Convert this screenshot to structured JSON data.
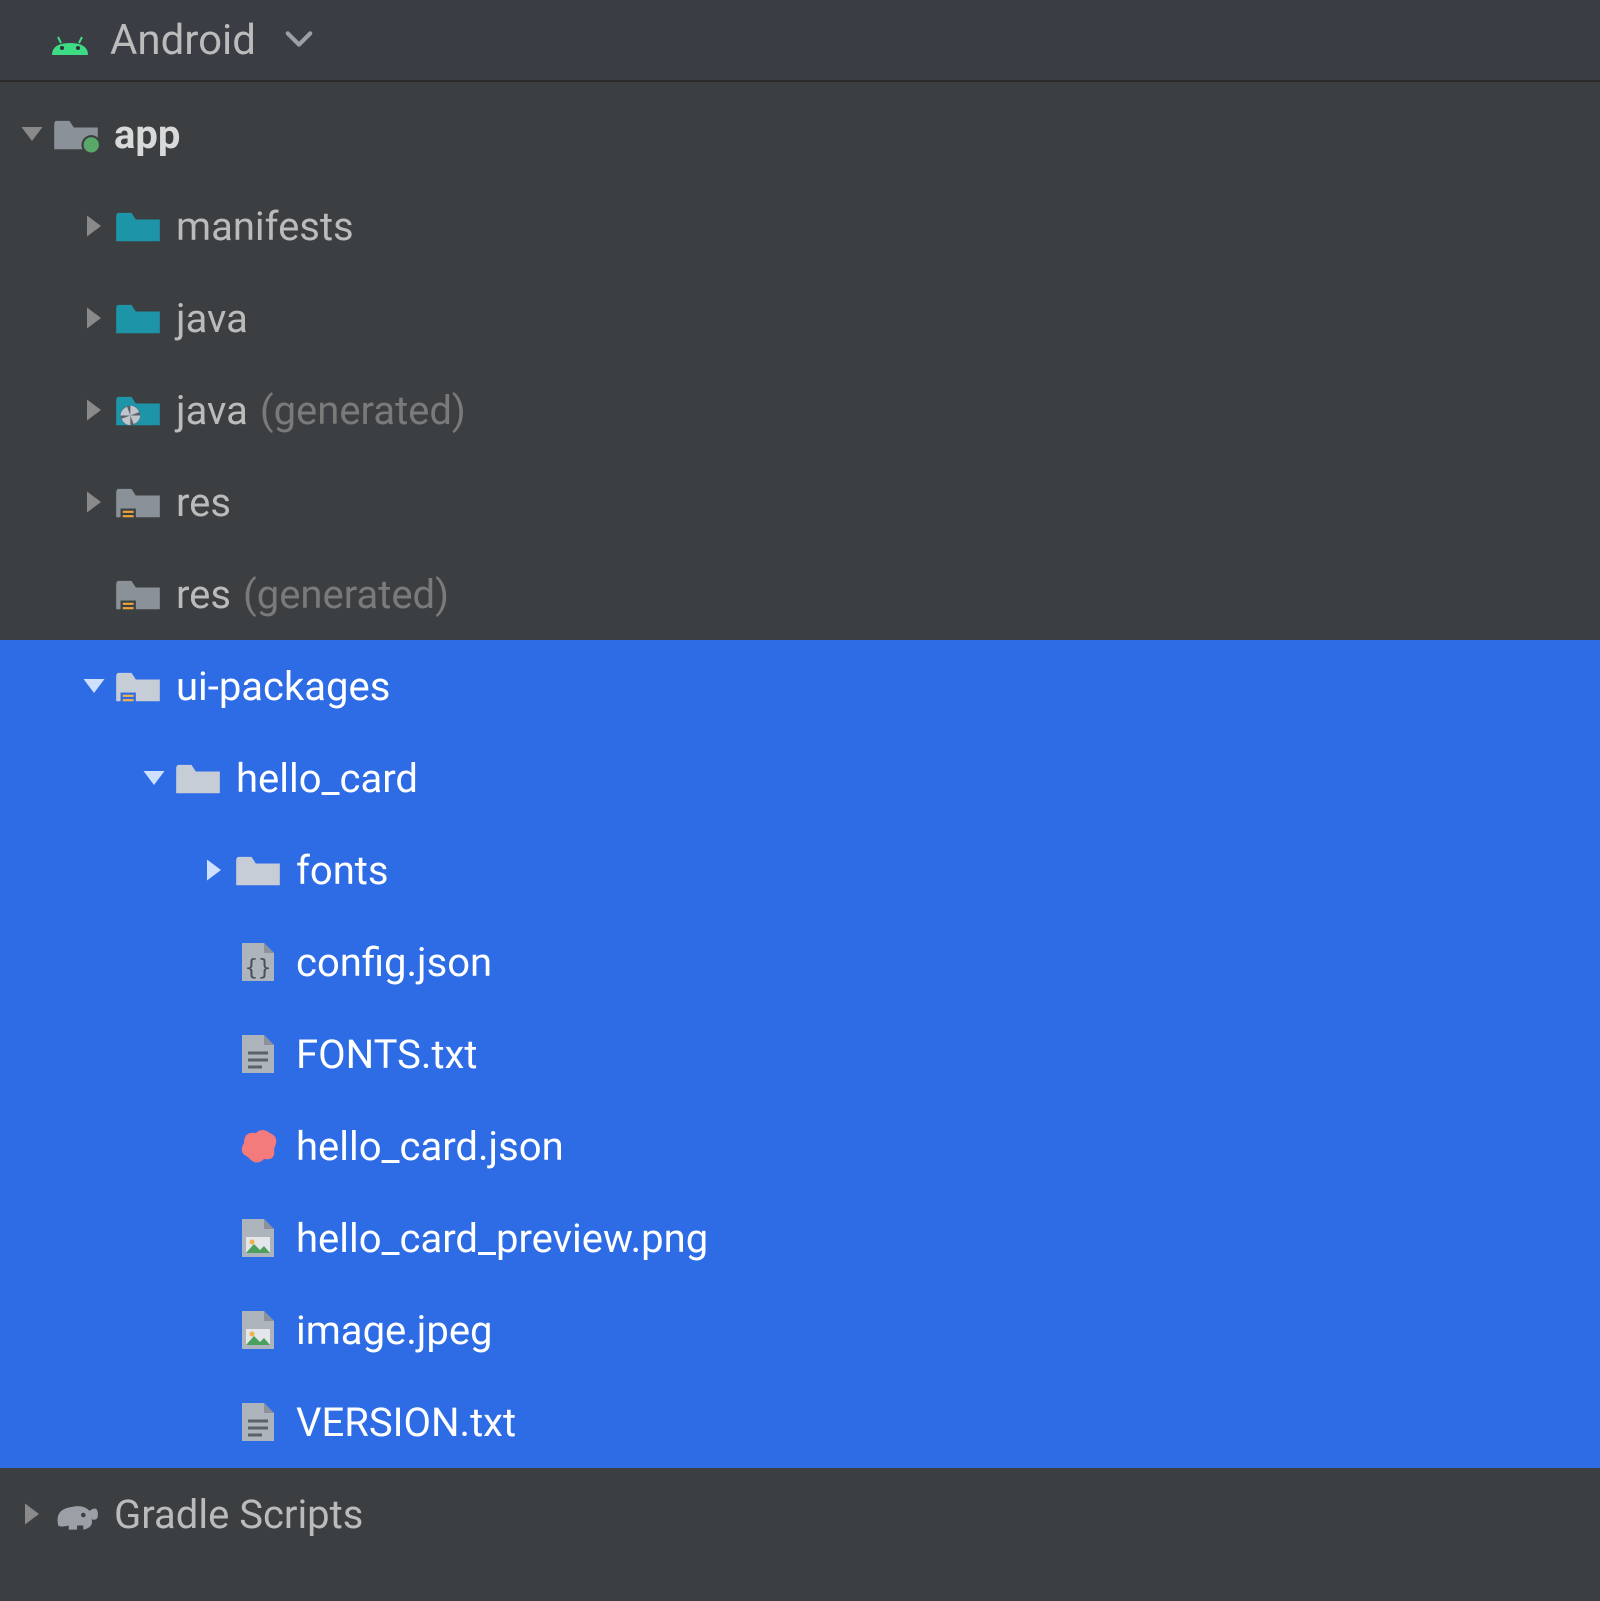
{
  "header": {
    "view_label": "Android"
  },
  "tree": {
    "app": {
      "label": "app"
    },
    "manifests": {
      "label": "manifests"
    },
    "java": {
      "label": "java"
    },
    "java_gen": {
      "label": "java",
      "suffix": "(generated)"
    },
    "res": {
      "label": "res"
    },
    "res_gen": {
      "label": "res",
      "suffix": "(generated)"
    },
    "ui_packages": {
      "label": "ui-packages"
    },
    "hello_card": {
      "label": "hello_card"
    },
    "fonts": {
      "label": "fonts"
    },
    "config_json": {
      "label": "config.json"
    },
    "fonts_txt": {
      "label": "FONTS.txt"
    },
    "hello_card_json": {
      "label": "hello_card.json"
    },
    "hello_card_preview": {
      "label": "hello_card_preview.png"
    },
    "image_jpeg": {
      "label": "image.jpeg"
    },
    "version_txt": {
      "label": "VERSION.txt"
    },
    "gradle_scripts": {
      "label": "Gradle Scripts"
    }
  }
}
